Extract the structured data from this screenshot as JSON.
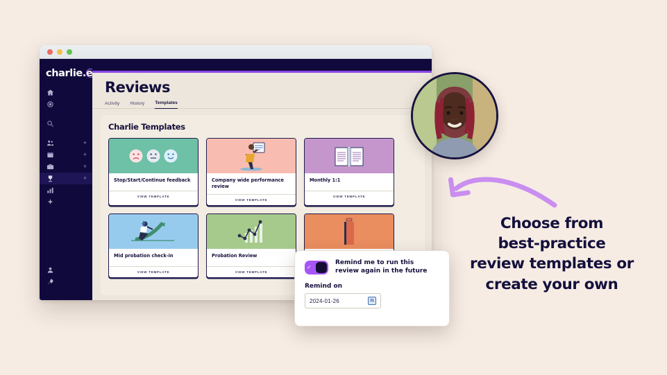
{
  "brand": {
    "logo_text": "charlie",
    "logo_accent": ".e",
    "navy": "#100a3c",
    "purple": "#8b45e8",
    "cream": "#f6ece4"
  },
  "window": {
    "traffic_lights": [
      "close-red",
      "minimize-yellow",
      "maximize-green"
    ]
  },
  "sidebar": {
    "top_items": [
      {
        "icon": "home-icon",
        "label": "Home",
        "plus": false,
        "active": false
      },
      {
        "icon": "target-icon",
        "label": "Goals",
        "plus": false,
        "active": false
      }
    ],
    "search": {
      "icon": "search-icon",
      "label": "Search"
    },
    "items": [
      {
        "icon": "people-icon",
        "label": "People",
        "plus": true,
        "active": false
      },
      {
        "icon": "calendar-icon",
        "label": "Calendar",
        "plus": true,
        "active": false
      },
      {
        "icon": "briefcase-icon",
        "label": "Jobs",
        "plus": true,
        "active": false
      },
      {
        "icon": "trophy-icon",
        "label": "Reviews",
        "plus": true,
        "active": true
      },
      {
        "icon": "chart-icon",
        "label": "Reports",
        "plus": false,
        "active": false
      },
      {
        "icon": "sparkle-icon",
        "label": "Insights",
        "plus": false,
        "active": false
      }
    ],
    "bottom_items": [
      {
        "icon": "support-icon",
        "label": "Support"
      },
      {
        "icon": "rocket-icon",
        "label": "Whats new"
      }
    ]
  },
  "page": {
    "title": "Reviews",
    "tabs": [
      {
        "label": "Activity",
        "active": false
      },
      {
        "label": "History",
        "active": false
      },
      {
        "label": "Templates",
        "active": true
      }
    ],
    "section_title": "Charlie Templates",
    "view_template_label": "VIEW TEMPLATE"
  },
  "templates": [
    {
      "title": "Stop/Start/Continue feedback",
      "color": "#6ec0a6",
      "art": "faces-icon"
    },
    {
      "title": "Company wide performance review",
      "color": "#f8bdb0",
      "art": "person-presenting-icon"
    },
    {
      "title": "Monthly 1:1",
      "color": "#c596cc",
      "art": "open-book-icon"
    },
    {
      "title": "Mid probation check-in",
      "color": "#97cbee",
      "art": "person-climbing-icon"
    },
    {
      "title": "Probation Review",
      "color": "#a6ca8c",
      "art": "growth-chart-icon"
    },
    {
      "title": "",
      "color": "#ea8d5f",
      "art": "document-icon"
    }
  ],
  "modal": {
    "toggle_on": true,
    "toggle_color": "#a855f7",
    "reminder_text": "Remind me to run this review again in the future",
    "remind_on_label": "Remind on",
    "date_value": "2024-01-26",
    "calendar_icon_text": "31"
  },
  "avatar": {
    "name": "user-avatar"
  },
  "callout": {
    "arrow": "curved-arrow-icon",
    "arrow_color": "#c98ef0",
    "lines": [
      "Choose from",
      "best-practice",
      "review templates or",
      "create your own"
    ]
  }
}
